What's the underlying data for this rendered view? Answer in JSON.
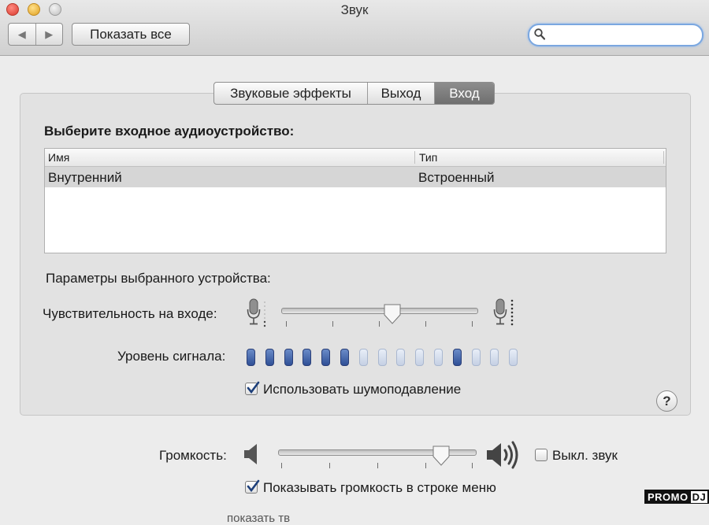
{
  "window": {
    "title": "Звук"
  },
  "toolbar": {
    "back_label": "◀",
    "forward_label": "▶",
    "show_all_label": "Показать все"
  },
  "search": {
    "placeholder": "",
    "value": ""
  },
  "tabs": [
    {
      "label": "Звуковые эффекты",
      "selected": false
    },
    {
      "label": "Выход",
      "selected": false
    },
    {
      "label": "Вход",
      "selected": true
    }
  ],
  "input": {
    "choose_label": "Выберите входное аудиоустройство:",
    "table": {
      "columns": [
        "Имя",
        "Тип"
      ],
      "rows": [
        {
          "name": "Внутренний",
          "type": "Встроенный",
          "selected": true
        }
      ]
    },
    "params_label": "Параметры выбранного устройства:",
    "sensitivity": {
      "label": "Чувствительность на входе:",
      "level": 0.57
    },
    "signal": {
      "label": "Уровень сигнала:",
      "leds": [
        1,
        1,
        1,
        1,
        1,
        1,
        0,
        0,
        0,
        0,
        0,
        1,
        0,
        0,
        0
      ]
    },
    "noise_reduction": {
      "label": "Использовать шумоподавление",
      "checked": true
    }
  },
  "help": {
    "label": "?"
  },
  "volume": {
    "label": "Громкость:",
    "level": 0.85,
    "mute": {
      "label": "Выкл. звук",
      "checked": false
    },
    "show_in_menu": {
      "label": "Показывать громкость в строке меню",
      "checked": true
    }
  },
  "watermark": {
    "promo": "PROMO",
    "dj": "DJ"
  },
  "cutoff_text": "показать тв",
  "colors": {
    "led_on": "#2f4f96",
    "led_off": "#c5d0e4",
    "selected_tab": "#7a7a7a",
    "search_ring": "#7aa7e0"
  }
}
